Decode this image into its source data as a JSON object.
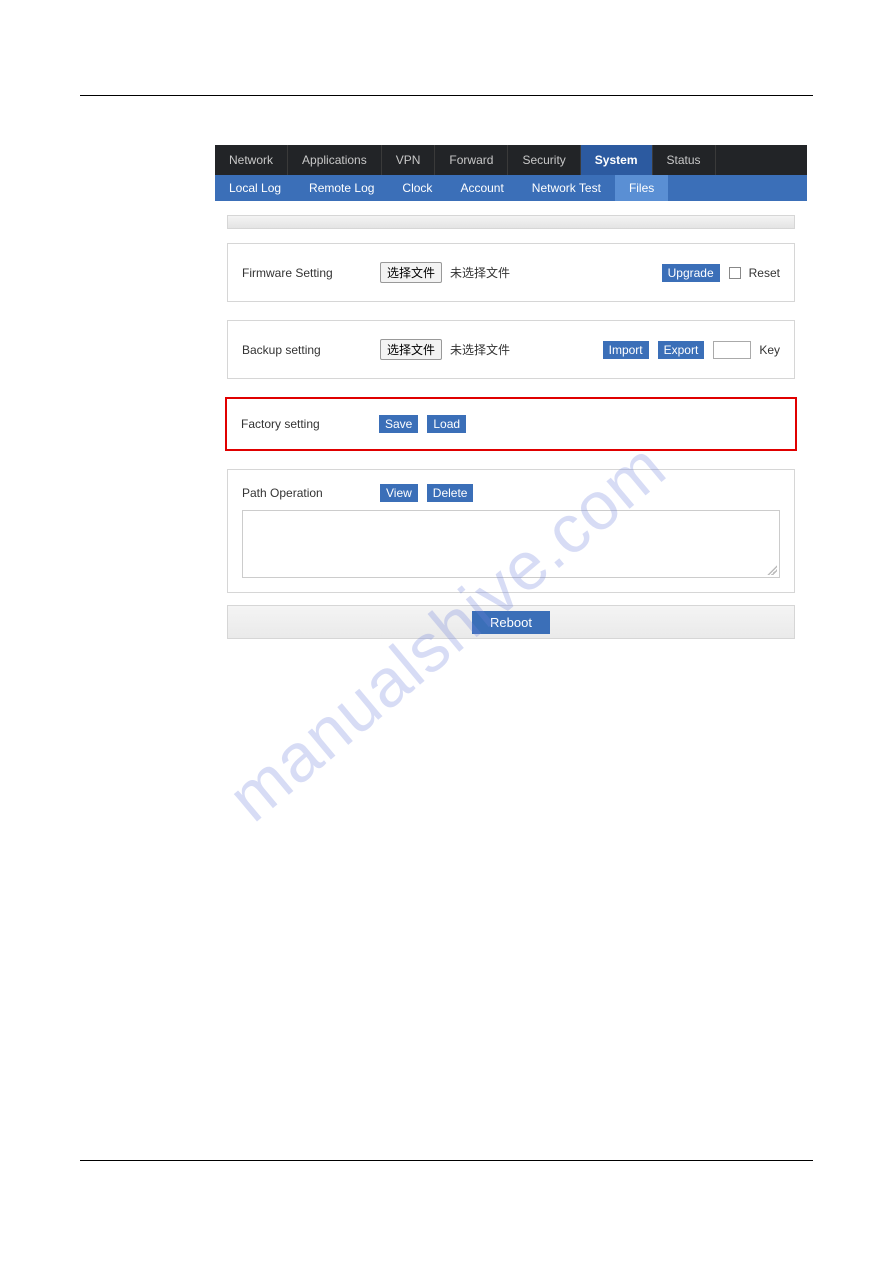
{
  "mainTabs": {
    "network": "Network",
    "applications": "Applications",
    "vpn": "VPN",
    "forward": "Forward",
    "security": "Security",
    "system": "System",
    "status": "Status"
  },
  "subTabs": {
    "localLog": "Local Log",
    "remoteLog": "Remote Log",
    "clock": "Clock",
    "account": "Account",
    "networkTest": "Network Test",
    "files": "Files"
  },
  "firmware": {
    "label": "Firmware Setting",
    "chooseFile": "选择文件",
    "noFile": "未选择文件",
    "upgrade": "Upgrade",
    "reset": "Reset"
  },
  "backup": {
    "label": "Backup setting",
    "chooseFile": "选择文件",
    "noFile": "未选择文件",
    "import": "Import",
    "export": "Export",
    "keyLabel": "Key",
    "keyValue": ""
  },
  "factory": {
    "label": "Factory setting",
    "save": "Save",
    "load": "Load"
  },
  "path": {
    "label": "Path Operation",
    "view": "View",
    "delete": "Delete",
    "content": ""
  },
  "reboot": "Reboot",
  "watermark": "manualshive.com"
}
